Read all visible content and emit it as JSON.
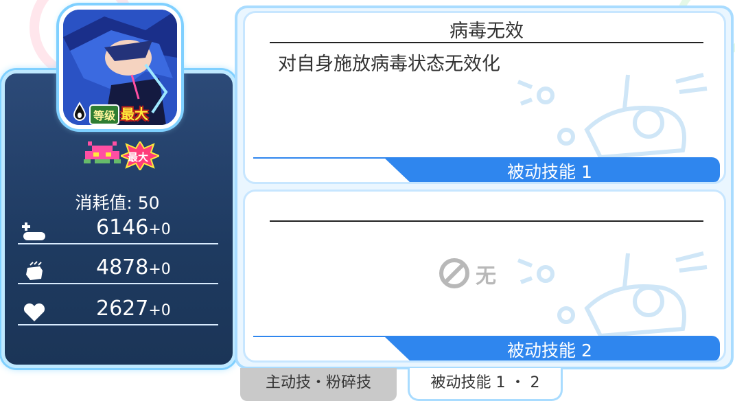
{
  "character": {
    "level_label": "等级",
    "level_value": "最大",
    "fusion_label": "最大",
    "cost_label": "消耗值",
    "cost_value": "50",
    "stats": [
      {
        "icon": "hp-icon",
        "value": "6146",
        "bonus": "+0"
      },
      {
        "icon": "attack-icon",
        "value": "4878",
        "bonus": "+0"
      },
      {
        "icon": "heal-icon",
        "value": "2627",
        "bonus": "+0"
      }
    ]
  },
  "skills": [
    {
      "title": "病毒无效",
      "description": "对自身施放病毒状态无效化",
      "slot_label": "被动技能 1"
    },
    {
      "title": "",
      "description": "",
      "empty_text": "无",
      "slot_label": "被动技能 2"
    }
  ],
  "tabs": [
    {
      "label": "主动技・粉碎技",
      "active": false
    },
    {
      "label": "被动技能 1 ・ 2",
      "active": true
    }
  ],
  "colors": {
    "panel_dark": "#1e3a60",
    "accent_blue": "#2f86ee",
    "frame_light": "#a9dcff"
  }
}
